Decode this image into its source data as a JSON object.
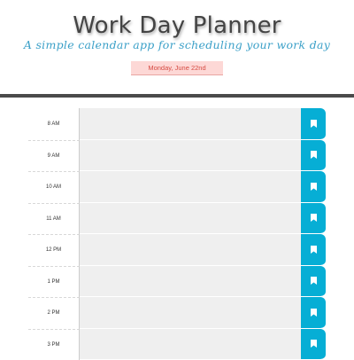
{
  "header": {
    "title": "Work Day Planner",
    "subtitle": "A simple calendar app for scheduling your work day",
    "current_date": "Monday, June 22nd"
  },
  "planner": {
    "hours": [
      {
        "label": "8 AM",
        "text": ""
      },
      {
        "label": "9 AM",
        "text": ""
      },
      {
        "label": "10 AM",
        "text": ""
      },
      {
        "label": "11 AM",
        "text": ""
      },
      {
        "label": "12 PM",
        "text": ""
      },
      {
        "label": "1 PM",
        "text": ""
      },
      {
        "label": "2 PM",
        "text": ""
      },
      {
        "label": "3 PM",
        "text": ""
      }
    ],
    "save_icon": "bookmark-icon"
  },
  "colors": {
    "save_button": "#06aed5",
    "date_badge_bg": "#fdd8d6",
    "date_badge_text": "#d64b43",
    "subtitle": "#3ba0c8",
    "description_bg": "#efefef"
  }
}
